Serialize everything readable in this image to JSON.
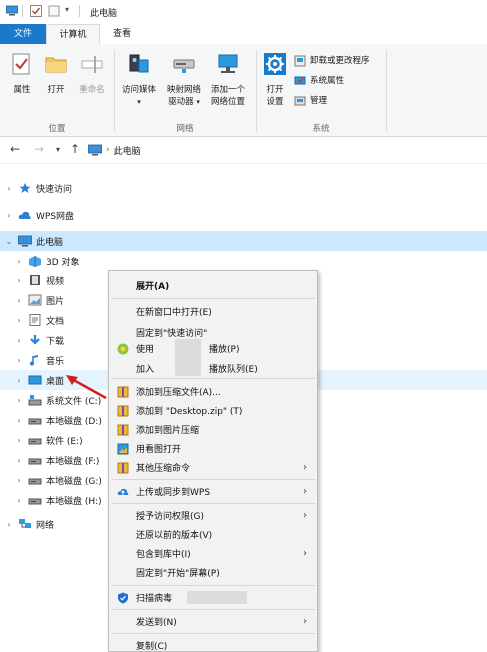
{
  "window": {
    "title": "此电脑"
  },
  "ribbon_tabs": [
    {
      "label": "文件"
    },
    {
      "label": "计算机"
    },
    {
      "label": "查看"
    }
  ],
  "ribbon": {
    "groups": {
      "location": {
        "label": "位置",
        "buttons": [
          {
            "label": "属性",
            "icon": "properties-icon"
          },
          {
            "label": "打开",
            "icon": "open-folder-icon"
          },
          {
            "label": "重命名",
            "icon": "rename-icon",
            "disabled": true
          }
        ]
      },
      "network": {
        "label": "网络",
        "buttons": [
          {
            "line1": "访问媒体",
            "line2": "",
            "icon": "media-icon",
            "dropdown": true
          },
          {
            "line1": "映射网络",
            "line2": "驱动器",
            "icon": "map-drive-icon",
            "dropdown": true
          },
          {
            "line1": "添加一个",
            "line2": "网络位置",
            "icon": "network-location-icon"
          }
        ]
      },
      "system": {
        "label": "系统",
        "big_button": {
          "line1": "打开",
          "line2": "设置",
          "icon": "settings-gear-icon"
        },
        "items": [
          {
            "label": "卸载或更改程序",
            "icon": "uninstall-icon"
          },
          {
            "label": "系统属性",
            "icon": "system-properties-icon"
          },
          {
            "label": "管理",
            "icon": "manage-icon"
          }
        ]
      }
    }
  },
  "address": {
    "path": "此电脑"
  },
  "tree": {
    "quick_access": "快速访问",
    "wps": "WPS网盘",
    "this_pc": "此电脑",
    "children": [
      {
        "label": "3D 对象",
        "icon": "3d-objects-icon"
      },
      {
        "label": "视频",
        "icon": "video-icon"
      },
      {
        "label": "图片",
        "icon": "pictures-icon"
      },
      {
        "label": "文档",
        "icon": "documents-icon"
      },
      {
        "label": "下载",
        "icon": "downloads-icon"
      },
      {
        "label": "音乐",
        "icon": "music-icon"
      },
      {
        "label": "桌面",
        "icon": "desktop-icon"
      },
      {
        "label": "系统文件 (C:)",
        "icon": "system-drive-icon"
      },
      {
        "label": "本地磁盘 (D:)",
        "icon": "drive-icon"
      },
      {
        "label": "软件 (E:)",
        "icon": "drive-icon"
      },
      {
        "label": "本地磁盘 (F:)",
        "icon": "drive-icon"
      },
      {
        "label": "本地磁盘 (G:)",
        "icon": "drive-icon"
      },
      {
        "label": "本地磁盘 (H:)",
        "icon": "drive-icon"
      }
    ],
    "network": "网络"
  },
  "context_menu": {
    "expand": "展开(A)",
    "open_new_window": "在新窗口中打开(E)",
    "pin_quick_access": "固定到\"快速访问\"",
    "use": "使用",
    "play": "播放(P)",
    "add": "加入",
    "play_queue": "播放队列(E)",
    "add_archive": "添加到压缩文件(A)...",
    "add_zip": "添加到 \"Desktop.zip\" (T)",
    "add_image_compress": "添加到图片压缩",
    "open_with_viewer": "用看图打开",
    "other_compress": "其他压缩命令",
    "upload_wps": "上传或同步到WPS",
    "grant_access": "授予访问权限(G)",
    "restore_versions": "还原以前的版本(V)",
    "include_library": "包含到库中(I)",
    "pin_start": "固定到\"开始\"屏幕(P)",
    "scan_virus": "扫描病毒",
    "send_to": "发送到(N)",
    "copy": "复制(C)"
  }
}
